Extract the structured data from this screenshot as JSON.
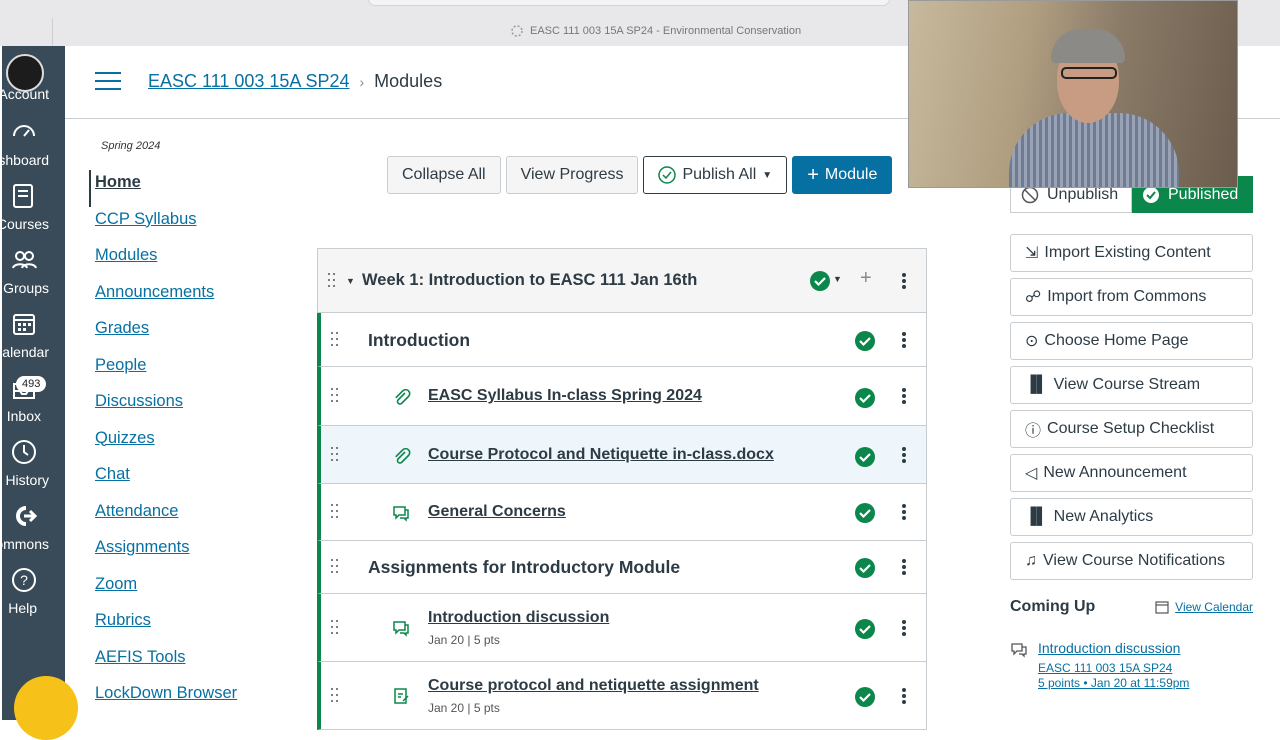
{
  "browser": {
    "tab_title": "EASC 111 003 15A SP24 - Environmental Conservation"
  },
  "global_nav": [
    {
      "label": "Account"
    },
    {
      "label": "Dashboard"
    },
    {
      "label": "Courses"
    },
    {
      "label": "Groups"
    },
    {
      "label": "Calendar"
    },
    {
      "label": "Inbox",
      "badge": "493"
    },
    {
      "label": "History"
    },
    {
      "label": "Commons"
    },
    {
      "label": "Help"
    }
  ],
  "header": {
    "course_link": "EASC 111 003 15A SP24",
    "separator": "›",
    "current": "Modules"
  },
  "course_nav": {
    "term": "Spring 2024",
    "items": [
      "Home",
      "CCP Syllabus",
      "Modules",
      "Announcements",
      "Grades",
      "People",
      "Discussions",
      "Quizzes",
      "Chat",
      "Attendance",
      "Assignments",
      "Zoom",
      "Rubrics",
      "AEFIS Tools",
      "LockDown Browser"
    ]
  },
  "toolbar": {
    "collapse_all": "Collapse All",
    "view_progress": "View Progress",
    "publish_all": "Publish All",
    "add_module": "Module"
  },
  "module": {
    "title": "Week 1: Introduction to EASC 111 Jan 16th",
    "rows": [
      {
        "kind": "header",
        "title": "Introduction"
      },
      {
        "kind": "item",
        "icon": "attachment-icon",
        "title": "EASC Syllabus In-class Spring 2024",
        "meta": ""
      },
      {
        "kind": "item",
        "icon": "attachment-icon",
        "title": "Course Protocol and Netiquette in-class.docx",
        "meta": "",
        "highlight": true
      },
      {
        "kind": "item",
        "icon": "discussion-icon",
        "title": "General Concerns",
        "meta": ""
      },
      {
        "kind": "header",
        "title": "Assignments for Introductory Module"
      },
      {
        "kind": "item",
        "icon": "discussion-icon",
        "title": "Introduction discussion",
        "meta": "Jan 20  |  5 pts"
      },
      {
        "kind": "item",
        "icon": "assignment-icon",
        "title": "Course protocol and netiquette assignment",
        "meta": "Jan 20  |  5 pts"
      }
    ]
  },
  "sidebar": {
    "unpublish": "Unpublish",
    "published": "Published",
    "buttons": [
      {
        "label": "Import Existing Content",
        "icon": "import-icon"
      },
      {
        "label": "Import from Commons",
        "icon": "commons-icon"
      },
      {
        "label": "Choose Home Page",
        "icon": "target-icon"
      },
      {
        "label": "View Course Stream",
        "icon": "bar-chart-icon"
      },
      {
        "label": "Course Setup Checklist",
        "icon": "question-icon"
      },
      {
        "label": "New Announcement",
        "icon": "megaphone-icon"
      },
      {
        "label": "New Analytics",
        "icon": "bar-chart-icon"
      },
      {
        "label": "View Course Notifications",
        "icon": "bell-icon"
      }
    ],
    "coming_up": {
      "heading": "Coming Up",
      "view_calendar": "View Calendar",
      "item_title": "Introduction discussion",
      "item_course": "EASC 111 003 15A SP24",
      "item_detail": "5 points • Jan 20 at 11:59pm"
    }
  },
  "colors": {
    "brand": "#0770a3",
    "success": "#0b874b",
    "nav_bg": "#394b58"
  }
}
